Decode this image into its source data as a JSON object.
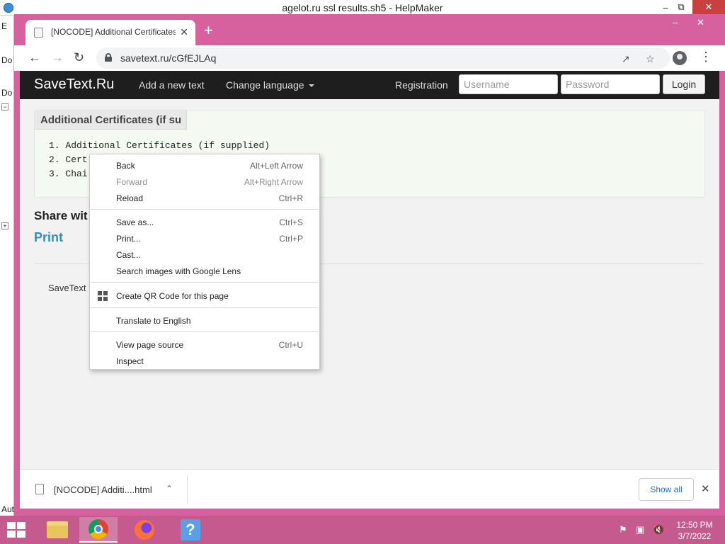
{
  "outer_window": {
    "title": "agelot.ru ssl results.sh5 - HelpMaker",
    "left_panel": [
      "E",
      "Do",
      "Do",
      "Aut"
    ]
  },
  "browser": {
    "tab_title": "[NOCODE] Additional Certificates",
    "new_tab_symbol": "+",
    "url": "savetext.ru/cGfEJLAq"
  },
  "site": {
    "brand": "SaveText.Ru",
    "nav": {
      "add_text": "Add a new text",
      "change_language": "Change language",
      "registration": "Registration",
      "username_placeholder": "Username",
      "password_placeholder": "Password",
      "login": "Login"
    },
    "panel_title": "Additional Certificates (if su",
    "lines": [
      "1. Additional Certificates (if supplied)",
      "2. Cert",
      "3. Chai"
    ],
    "share_title": "Share wit",
    "print_link": "Print",
    "footer_text": "SaveText"
  },
  "context_menu": {
    "items": [
      {
        "label": "Back",
        "shortcut": "Alt+Left Arrow",
        "enabled": true
      },
      {
        "label": "Forward",
        "shortcut": "Alt+Right Arrow",
        "enabled": false
      },
      {
        "label": "Reload",
        "shortcut": "Ctrl+R",
        "enabled": true
      },
      {
        "label": "Save as...",
        "shortcut": "Ctrl+S",
        "enabled": true
      },
      {
        "label": "Print...",
        "shortcut": "Ctrl+P",
        "enabled": true
      },
      {
        "label": "Cast...",
        "shortcut": "",
        "enabled": true
      },
      {
        "label": "Search images with Google Lens",
        "shortcut": "",
        "enabled": true
      },
      {
        "label": "Create QR Code for this page",
        "shortcut": "",
        "enabled": true,
        "icon": "qr-code-icon"
      },
      {
        "label": "Translate to English",
        "shortcut": "",
        "enabled": true
      },
      {
        "label": "View page source",
        "shortcut": "Ctrl+U",
        "enabled": true
      },
      {
        "label": "Inspect",
        "shortcut": "",
        "enabled": true
      }
    ]
  },
  "download_bar": {
    "file_name": "[NOCODE] Additi....html",
    "show_all": "Show all"
  },
  "taskbar": {
    "apps": [
      "file-explorer-icon",
      "chrome-icon",
      "firefox-icon",
      "helpmaker-icon"
    ],
    "time": "12:50 PM",
    "date": "3/7/2022"
  },
  "colors": {
    "chrome_frame": "#d7609e",
    "taskbar": "#c45a8d",
    "site_nav": "#1e1e1e",
    "link": "#2a90c8"
  }
}
